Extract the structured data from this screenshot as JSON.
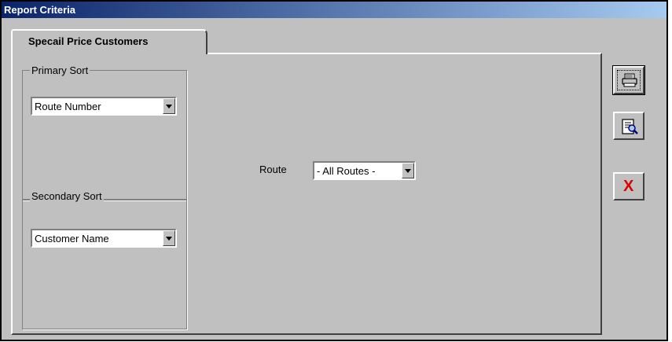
{
  "window": {
    "title": "Report Criteria"
  },
  "tab": {
    "label": "Specail Price Customers"
  },
  "primary_sort": {
    "label": "Primary Sort",
    "selected": "Route Number"
  },
  "secondary_sort": {
    "label": "Secondary Sort",
    "selected": "Customer Name"
  },
  "route": {
    "label": "Route",
    "selected": "- All Routes -"
  },
  "toolbar": {
    "print_icon": "printer-icon",
    "preview_icon": "print-preview-icon",
    "close_icon": "close-icon",
    "close_glyph": "X"
  }
}
